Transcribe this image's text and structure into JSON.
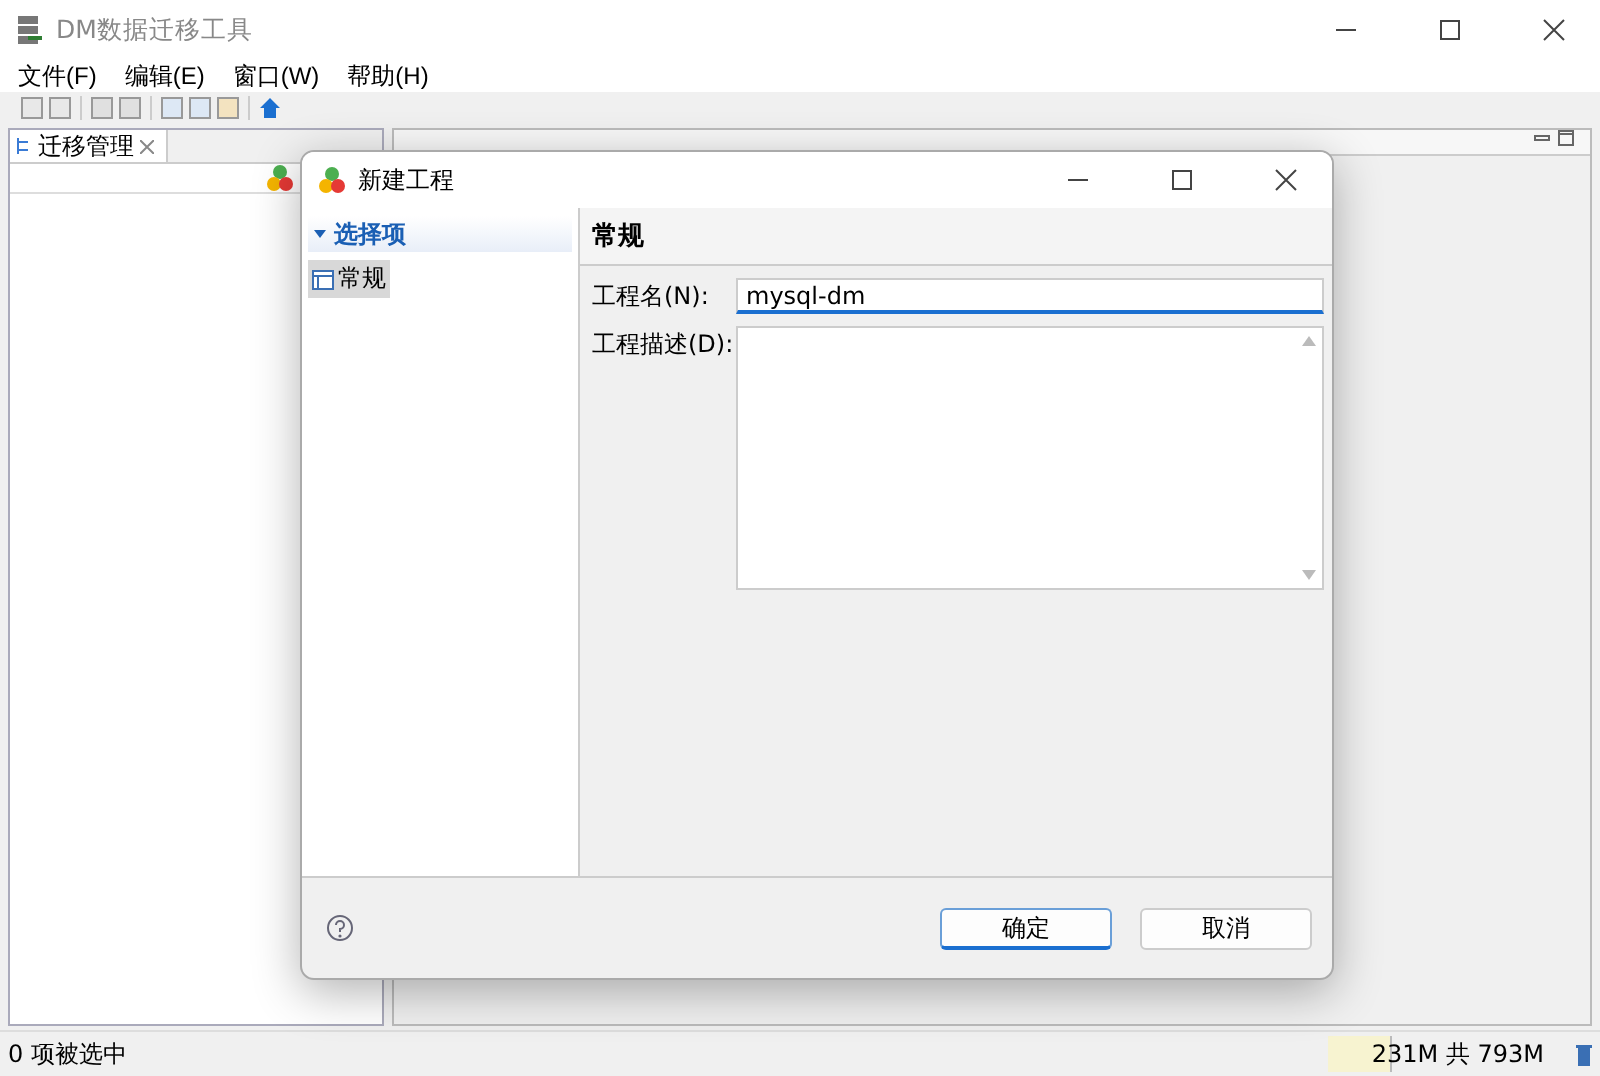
{
  "window": {
    "title": "DM数据迁移工具"
  },
  "menu": [
    "文件(F)",
    "编辑(E)",
    "窗口(W)",
    "帮助(H)"
  ],
  "left_panel": {
    "tab": "迁移管理"
  },
  "dialog": {
    "title": "新建工程",
    "tree": {
      "label": "选择项",
      "expanded": true,
      "children": [
        {
          "label": "常规",
          "selected": true
        }
      ]
    },
    "section_title": "常规",
    "fields": [
      {
        "label": "工程名(N):",
        "value": "mysql-dm",
        "kind": "line"
      },
      {
        "label": "工程描述(D):",
        "kind": "area"
      }
    ],
    "buttons": [
      {
        "label": "确定",
        "default": true
      },
      {
        "label": "取消",
        "default": false
      }
    ]
  },
  "status_bar": {
    "text": "0 项被选中",
    "memory": "231M 共 793M",
    "level": 0.29
  }
}
